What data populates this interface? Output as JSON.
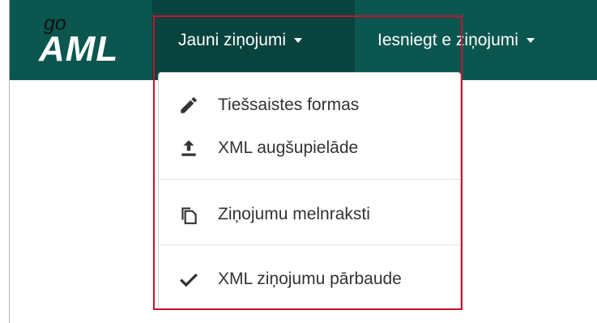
{
  "logo": {
    "prefix": "go",
    "name": "AML"
  },
  "nav": {
    "items": [
      {
        "label": "Jauni ziņojumi"
      },
      {
        "label": "Iesniegt e ziņojumi"
      }
    ]
  },
  "dropdown": {
    "items": [
      {
        "label": "Tiešsaistes formas",
        "icon": "pencil-icon"
      },
      {
        "label": "XML augšupielāde",
        "icon": "upload-icon"
      },
      {
        "label": "Ziņojumu melnraksti",
        "icon": "copy-icon"
      },
      {
        "label": "XML ziņojumu pārbaude",
        "icon": "check-icon"
      }
    ]
  },
  "colors": {
    "navbar": "#0b5750",
    "nav_active": "#08433d",
    "highlight": "#c8102e"
  }
}
